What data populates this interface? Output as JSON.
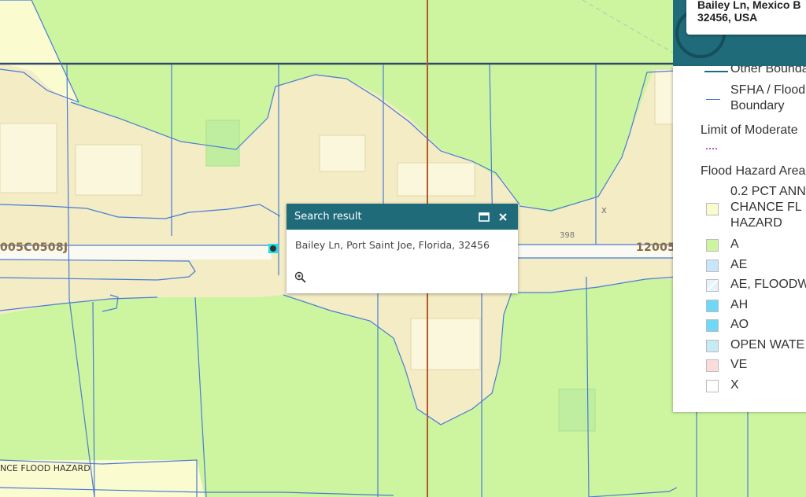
{
  "popup": {
    "title": "Search result",
    "address": "Bailey Ln, Port Saint Joe, Florida, 32456",
    "maximize_icon": "maximize-icon",
    "close_icon": "close-icon",
    "zoom_icon": "zoom-to-icon"
  },
  "top_card": {
    "line1": "Bailey Ln, Mexico B",
    "line2": "32456, USA"
  },
  "map_labels": {
    "panel_left": "005C0508J",
    "panel_right": "12005",
    "parcel_number": "398",
    "zone_x": "X",
    "zone_bottom": "NCE FLOOD HAZARD"
  },
  "legend": {
    "other_boundaries": "Other Bounda",
    "sfha_line1": "SFHA / Flood",
    "sfha_line2": "Boundary",
    "limit_moderate": "Limit of Moderate",
    "flood_hazard_areas": "Flood Hazard Area",
    "items": [
      {
        "label_lines": [
          "0.2 PCT ANN",
          "CHANCE FL",
          "HAZARD"
        ],
        "color": "#fbfbd0"
      },
      {
        "label_lines": [
          "A"
        ],
        "color": "#cdf5a0"
      },
      {
        "label_lines": [
          "AE"
        ],
        "color": "#c8e6fb"
      },
      {
        "label_lines": [
          "AE, FLOODW"
        ],
        "color": "#e6f3fb"
      },
      {
        "label_lines": [
          "AH"
        ],
        "color": "#6fd8f7"
      },
      {
        "label_lines": [
          "AO"
        ],
        "color": "#6fd8f7"
      },
      {
        "label_lines": [
          "OPEN WATE"
        ],
        "color": "#c8eaf7"
      },
      {
        "label_lines": [
          "VE"
        ],
        "color": "#fbdcdc"
      },
      {
        "label_lines": [
          "X"
        ],
        "color": "#ffffff"
      }
    ]
  },
  "colors": {
    "zone_a": "#cdf5a0",
    "zone_x": "#f3ecc4",
    "zone_02": "#fbfbd0",
    "parcel_line": "#4a7bd6",
    "header": "#1f6b7a"
  }
}
